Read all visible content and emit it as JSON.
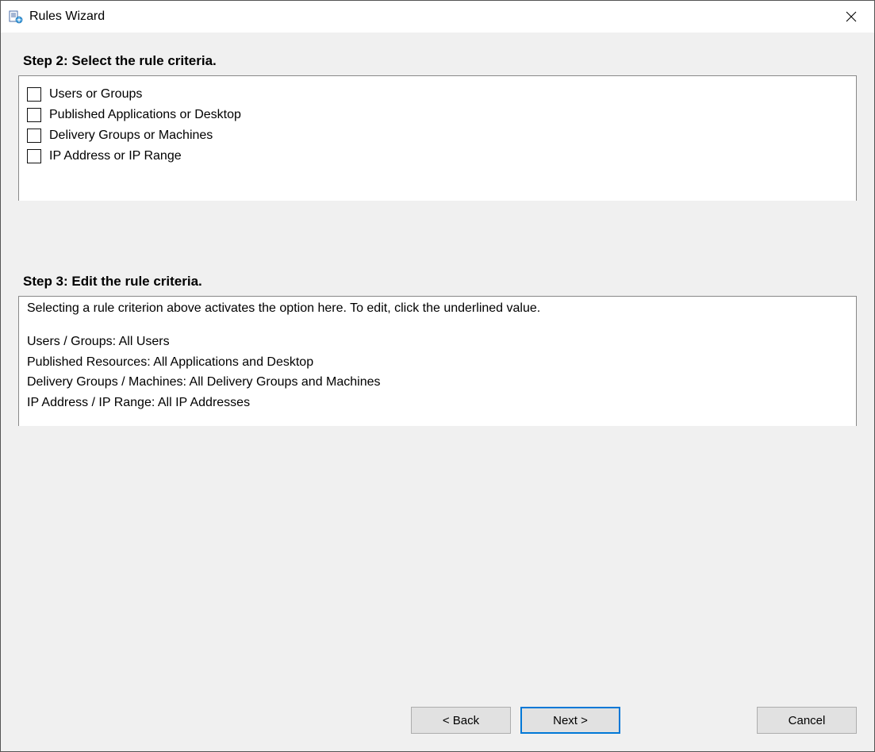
{
  "titlebar": {
    "title": "Rules Wizard"
  },
  "step2": {
    "heading": "Step 2: Select the rule criteria.",
    "criteria": [
      {
        "label": "Users or Groups"
      },
      {
        "label": "Published Applications or Desktop"
      },
      {
        "label": "Delivery Groups or Machines"
      },
      {
        "label": "IP Address or IP Range"
      }
    ]
  },
  "step3": {
    "heading": "Step 3: Edit the rule criteria.",
    "instruction": "Selecting a rule criterion above activates the option here. To edit, click the underlined value.",
    "lines": [
      "Users / Groups: All Users",
      "Published Resources: All Applications and Desktop",
      "Delivery Groups / Machines: All Delivery Groups and Machines",
      "IP Address / IP Range: All IP Addresses"
    ]
  },
  "buttons": {
    "back": "< Back",
    "next": "Next >",
    "cancel": "Cancel"
  }
}
